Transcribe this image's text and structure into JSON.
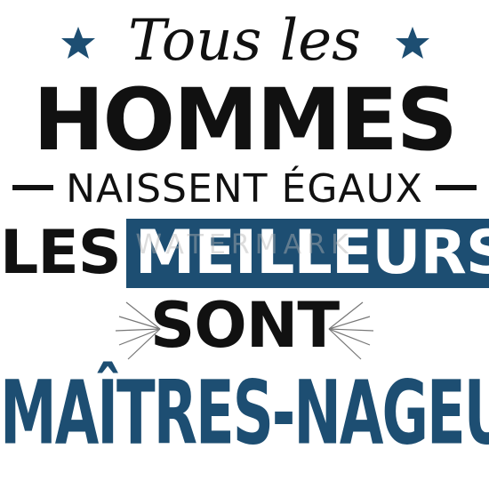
{
  "design": {
    "line1": "Tous les",
    "line2": "HOMMES",
    "line3": "NAISSENT ÉGAUX",
    "line4_black": "LES",
    "line4_box": "MEILLEURS",
    "line5": "SONT",
    "line6": "MAÎTRES-NAGEURS",
    "watermark": "WATERMARK"
  },
  "colors": {
    "accent": "#1d4e72",
    "text": "#111111",
    "background": "#ffffff"
  },
  "icons": {
    "left_star": "star-icon",
    "right_star": "star-icon"
  }
}
